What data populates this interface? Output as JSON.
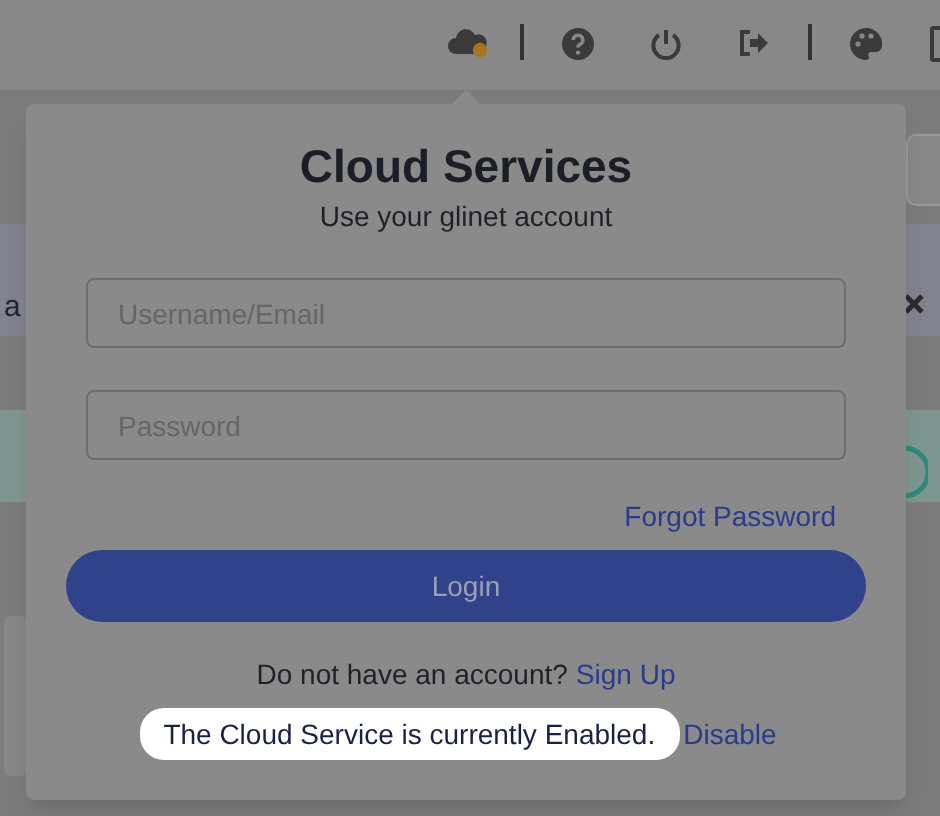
{
  "background": {
    "text_fragment": "a"
  },
  "dialog": {
    "title": "Cloud Services",
    "subtitle": "Use your glinet account",
    "fields": [
      {
        "placeholder": "Username/Email"
      },
      {
        "placeholder": "Password"
      }
    ],
    "forgot_link": "Forgot Password",
    "login_button": "Login",
    "signup_prompt": "Do not have an account?",
    "signup_link": "Sign Up",
    "status": {
      "text": "The Cloud Service is currently Enabled.",
      "highlighted": true
    },
    "disable_link": "Disable"
  }
}
